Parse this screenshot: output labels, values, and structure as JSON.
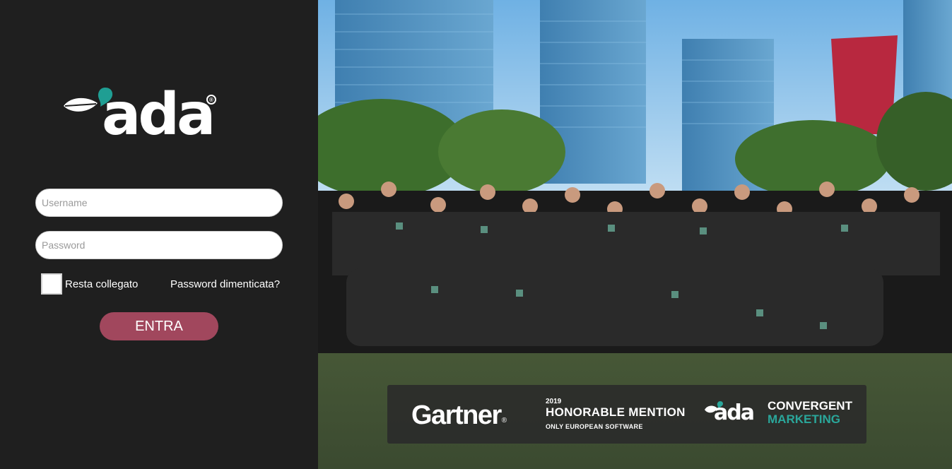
{
  "brand": {
    "logo_text": "ada",
    "registered_mark": "®",
    "leaf_color": "#ffffff",
    "drop_color": "#1f9e93"
  },
  "login": {
    "username_placeholder": "Username",
    "password_placeholder": "Password",
    "remember_label": "Resta collegato",
    "forgot_label": "Password dimenticata?",
    "submit_label": "ENTRA",
    "submit_color": "#a1475d"
  },
  "banner": {
    "gartner": "Gartner",
    "gartner_mark": "®",
    "year": "2019",
    "honorable": "HONORABLE MENTION",
    "sub": "ONLY EUROPEAN SOFTWARE",
    "mini_logo": "ada",
    "convergent": "CONVERGENT",
    "marketing": "MARKETING",
    "accent": "#2aa79b"
  },
  "photo": {
    "description_icon": "team-photo"
  }
}
